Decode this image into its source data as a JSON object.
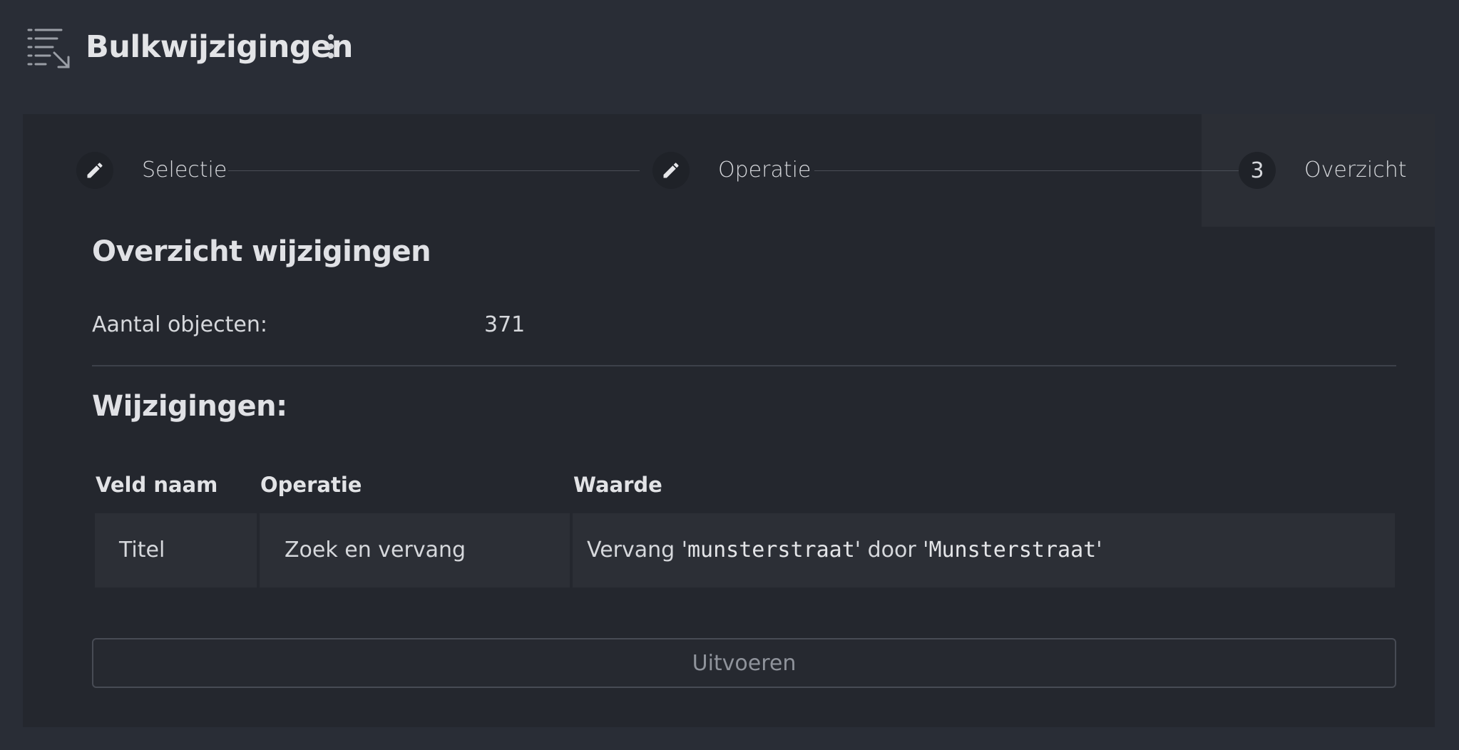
{
  "header": {
    "title": "Bulkwijzigingen",
    "icon": "bulk-list-icon",
    "menu_icon": "more-vertical-icon"
  },
  "stepper": {
    "steps": [
      {
        "label": "Selectie",
        "icon": "pencil-icon",
        "state": "completed"
      },
      {
        "label": "Operatie",
        "icon": "pencil-icon",
        "state": "completed"
      },
      {
        "label": "Overzicht",
        "number": "3",
        "state": "active"
      }
    ]
  },
  "overview": {
    "title": "Overzicht wijzigingen",
    "count_label": "Aantal objecten:",
    "count_value": "371"
  },
  "changes": {
    "title": "Wijzigingen:",
    "columns": [
      "Veld naam",
      "Operatie",
      "Waarde"
    ],
    "rows": [
      {
        "field": "Titel",
        "operation": "Zoek en vervang",
        "value_prefix": "Vervang '",
        "search": "munsterstraat",
        "value_mid": "' door '",
        "replace": "Munsterstraat",
        "value_suffix": "'"
      }
    ]
  },
  "actions": {
    "execute_label": "Uitvoeren"
  },
  "colors": {
    "background": "#292d36",
    "card": "#24272e",
    "text": "#d6d8dc"
  }
}
